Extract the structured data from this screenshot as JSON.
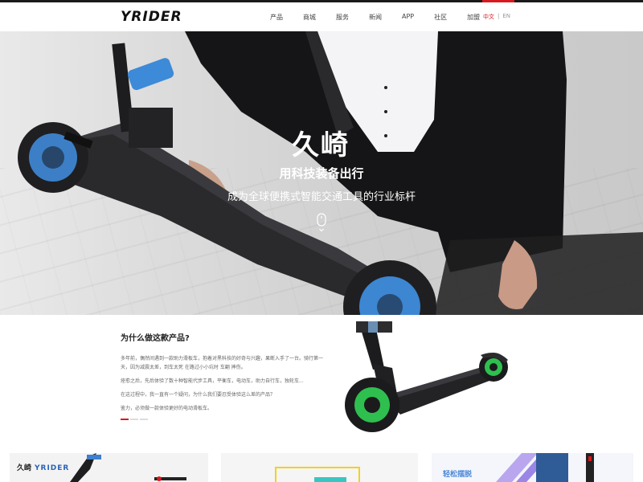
{
  "colors": {
    "accent": "#d7191f",
    "dark": "#1a1a1a",
    "link_blue": "#2b63b8"
  },
  "header": {
    "logo": "YRIDER",
    "nav": [
      "产品",
      "商城",
      "服务",
      "新闻",
      "APP",
      "社区",
      "加盟"
    ],
    "lang_cn": "中文",
    "lang_sep": "|",
    "lang_en": "EN"
  },
  "hero": {
    "brand": "久崎",
    "slogan": "用科技装备出行",
    "subtitle": "成为全球便携式智能交通工具的行业标杆",
    "scroll_icon": "mouse-scroll-icon"
  },
  "why": {
    "title": "为什么做这款产品?",
    "paragraphs": [
      "多年前，偶然间遇到一款助力滑板车，抱着对黑科技的好奇与兴趣，果断入手了一台。骑行第一天，因为减震太差，到车太死 在路过小小坑时 车翻 摔伤。",
      "痊愈之后，先后体验了数十种智能代步工具，平衡车，电动车，助力自行车，独轮车...",
      "在这过程中，我一直有一个疑问，为什么我们要忍受体验这么差的产品？",
      "鉴力，必须做一款体验更好的电动滑板车。"
    ],
    "slides": 3,
    "active_slide": 0
  },
  "cards": {
    "card1": {
      "title_cn": "久崎",
      "title_en": "YRIDER"
    },
    "card3": {
      "title": "轻松摆脱"
    }
  }
}
